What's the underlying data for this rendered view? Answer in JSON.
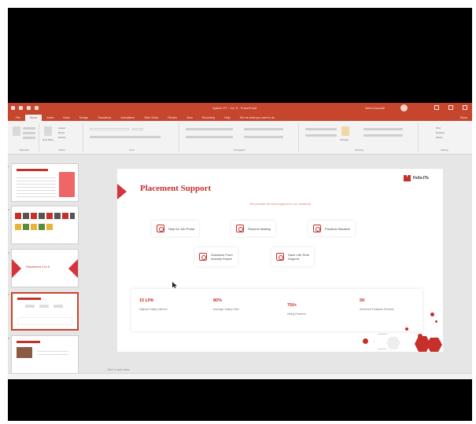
{
  "titlebar": {
    "doc_title": "Aptech PT - Vol. 5 - PowerPoint",
    "user": "Neha Kaushik"
  },
  "ribbon": {
    "tabs": [
      "File",
      "Home",
      "Insert",
      "Draw",
      "Design",
      "Transitions",
      "Animations",
      "Slide Show",
      "Review",
      "View",
      "Recording",
      "Help",
      "Tell me what you want to do"
    ],
    "active_tab": "Home",
    "share": "Share",
    "groups": {
      "clipboard": "Clipboard",
      "slides": "Slides",
      "font": "Font",
      "paragraph": "Paragraph",
      "drawing": "Drawing",
      "editing": "Editing"
    },
    "slides_buttons": [
      "Layout",
      "Reset",
      "Section"
    ],
    "editing_buttons": [
      "Find",
      "Replace",
      "Select"
    ],
    "new_slide": "New Slide",
    "arrange": "Arrange"
  },
  "thumbnails": [
    {
      "num": "1"
    },
    {
      "num": "2"
    },
    {
      "num": "3",
      "label": "Placement 4 to 5"
    },
    {
      "num": "4"
    },
    {
      "num": "5"
    }
  ],
  "slide": {
    "title": "Placement Support",
    "subtitle": "We provide the best support to our students",
    "brand": "Felix-ITs",
    "features_row1": [
      {
        "label": "Help for Job Portal",
        "icon": "portal-icon"
      },
      {
        "label": "Resume Making",
        "icon": "resume-icon"
      },
      {
        "label": "Practical Situation",
        "icon": "practical-icon"
      }
    ],
    "features_row2": [
      {
        "label": "Guidance From\nIndustry Expert",
        "icon": "expert-icon"
      },
      {
        "label": "Have Life-Time\nSupport",
        "icon": "support-icon"
      }
    ],
    "stats": [
      {
        "value": "15 LPA",
        "label": "Highest Salary offered"
      },
      {
        "value": "80%",
        "label": "Average Salary Hike"
      },
      {
        "value": "750+",
        "label": "Hiring Partners"
      },
      {
        "value": "5K",
        "label": "Achieved Fullstack Dreams"
      }
    ]
  },
  "notes_placeholder": "Click to add notes",
  "colors": {
    "accent": "#c5452d",
    "slide_red": "#c5302a"
  }
}
